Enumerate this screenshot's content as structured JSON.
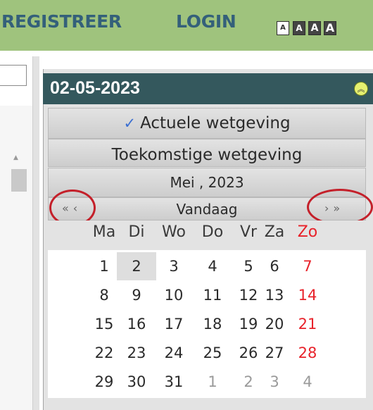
{
  "topbar": {
    "register_label": "REGISTREER",
    "login_label": "LOGIN",
    "font_size_buttons": [
      "A",
      "A",
      "A",
      "A"
    ]
  },
  "calendar": {
    "selected_date": "02-05-2023",
    "current_law_label": "Actuele wetgeving",
    "future_law_label": "Toekomstige wetgeving",
    "month_label": "Mei , 2023",
    "nav": {
      "prev_year": "«",
      "prev_month": "‹",
      "today": "Vandaag",
      "next_month": "›",
      "next_year": "»"
    },
    "weekdays": [
      "Ma",
      "Di",
      "Wo",
      "Do",
      "Vr",
      "Za",
      "Zo"
    ],
    "weeks": [
      [
        "1",
        "2",
        "3",
        "4",
        "5",
        "6",
        "7"
      ],
      [
        "8",
        "9",
        "10",
        "11",
        "12",
        "13",
        "14"
      ],
      [
        "15",
        "16",
        "17",
        "18",
        "19",
        "20",
        "21"
      ],
      [
        "22",
        "23",
        "24",
        "25",
        "26",
        "27",
        "28"
      ],
      [
        "29",
        "30",
        "31",
        "1",
        "2",
        "3",
        "4"
      ]
    ],
    "colors": {
      "header": "#34585d",
      "sunday": "#e8222a",
      "highlight_circle": "#c4202a",
      "topbar": "#9fc37d",
      "nav_text": "#34607a"
    }
  }
}
